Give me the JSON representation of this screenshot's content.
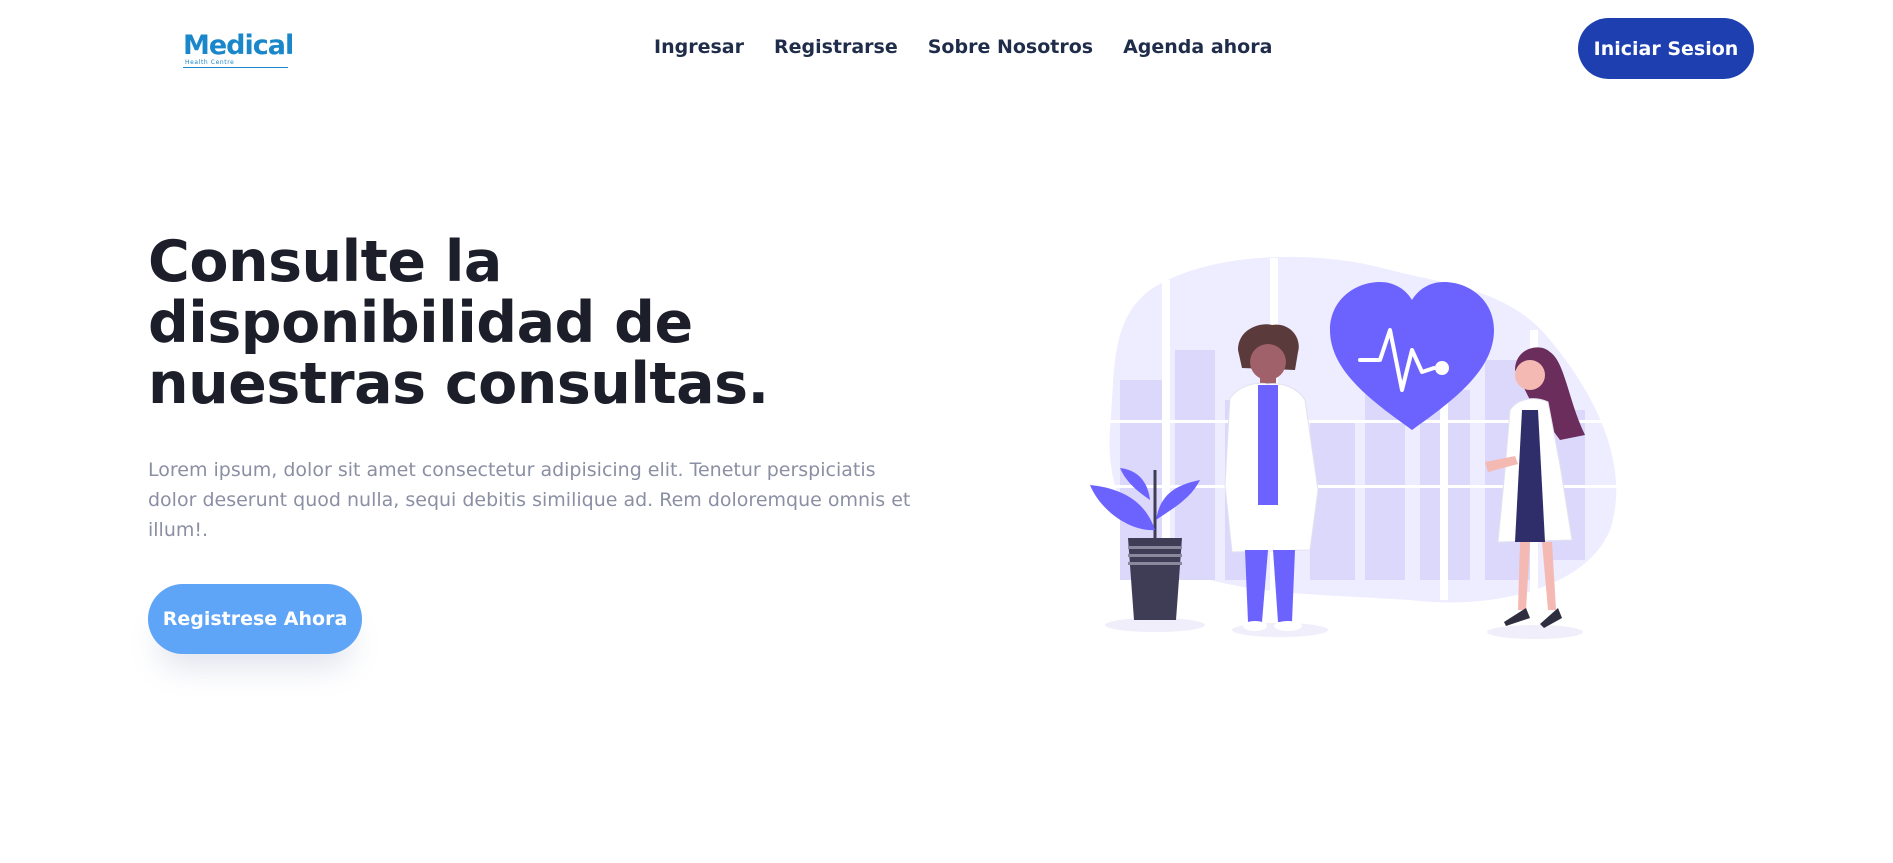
{
  "header": {
    "logo": {
      "name": "Medical",
      "tagline": "Health Centre"
    },
    "nav": [
      {
        "label": "Ingresar"
      },
      {
        "label": "Registrarse"
      },
      {
        "label": "Sobre Nosotros"
      },
      {
        "label": "Agenda ahora"
      }
    ],
    "login_button": "Iniciar Sesion"
  },
  "hero": {
    "title_lines": [
      "Consulte la",
      "disponibilidad de",
      "nuestras consultas."
    ],
    "description": "Lorem ipsum, dolor sit amet consectetur adipisicing elit. Tenetur perspiciatis dolor deserunt quod nulla, sequi debitis similique ad. Rem doloremque omnis et illum!.",
    "cta_label": "Registrese Ahora"
  },
  "colors": {
    "brand": "#1987c9",
    "login_button": "#1d3faf",
    "cta_button": "#5ea4f7",
    "illustration_accent": "#6c63ff"
  },
  "illustration": {
    "icons": [
      "heart-pulse-icon",
      "plant-icon",
      "doctor-male-icon",
      "doctor-female-icon"
    ]
  }
}
